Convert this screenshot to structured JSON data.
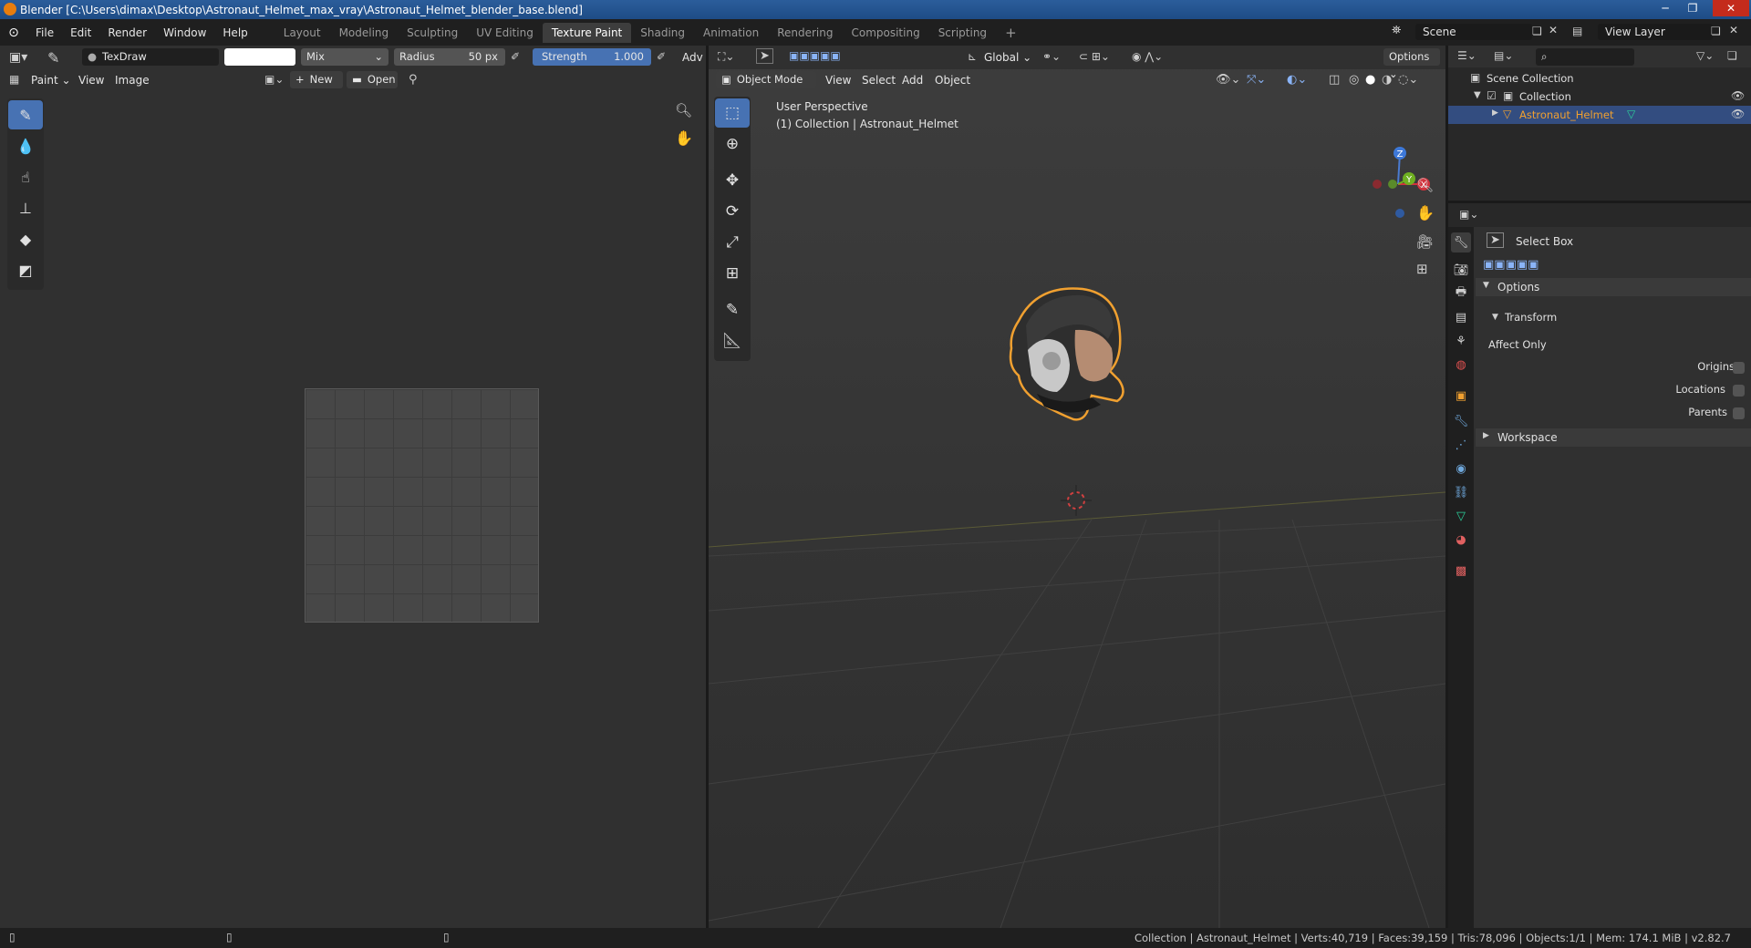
{
  "window": {
    "title": "Blender [C:\\Users\\dimax\\Desktop\\Astronaut_Helmet_max_vray\\Astronaut_Helmet_blender_base.blend]"
  },
  "menu": [
    "File",
    "Edit",
    "Render",
    "Window",
    "Help"
  ],
  "workspaces": [
    {
      "label": "Layout",
      "active": false
    },
    {
      "label": "Modeling",
      "active": false
    },
    {
      "label": "Sculpting",
      "active": false
    },
    {
      "label": "UV Editing",
      "active": false
    },
    {
      "label": "Texture Paint",
      "active": true
    },
    {
      "label": "Shading",
      "active": false
    },
    {
      "label": "Animation",
      "active": false
    },
    {
      "label": "Rendering",
      "active": false
    },
    {
      "label": "Compositing",
      "active": false
    },
    {
      "label": "Scripting",
      "active": false
    }
  ],
  "scene": {
    "name": "Scene",
    "view_layer": "View Layer"
  },
  "image_editor": {
    "brush_name": "TexDraw",
    "blend": "Mix",
    "radius_label": "Radius",
    "radius_value": "50 px",
    "strength_label": "Strength",
    "strength_value": "1.000",
    "adv_label": "Adv",
    "mode": "Paint",
    "view_menu": "View",
    "image_menu": "Image",
    "new_label": "New",
    "open_label": "Open"
  },
  "viewport": {
    "orientation": "Global",
    "options_label": "Options",
    "mode": "Object Mode",
    "menus": [
      "View",
      "Select",
      "Add",
      "Object"
    ],
    "perspective": "User Perspective",
    "collection_info": "(1) Collection | Astronaut_Helmet",
    "gizmo_axes": [
      "Z",
      "Y",
      "X"
    ]
  },
  "outliner": {
    "search_placeholder": "",
    "scene_collection": "Scene Collection",
    "collection": "Collection",
    "object": "Astronaut_Helmet"
  },
  "properties": {
    "tool_name": "Select Box",
    "options_label": "Options",
    "transform_label": "Transform",
    "affect_only": "Affect Only",
    "origins": "Origins",
    "locations": "Locations",
    "parents": "Parents",
    "workspace_label": "Workspace"
  },
  "status": {
    "text": "Collection | Astronaut_Helmet | Verts:40,719 | Faces:39,159 | Tris:78,096 | Objects:1/1 | Mem: 174.1 MiB | v2.82.7"
  },
  "colors": {
    "accent": "#4772b3",
    "selection_orange": "#f0a030",
    "header": "#303030",
    "bg": "#1f1f1f"
  }
}
